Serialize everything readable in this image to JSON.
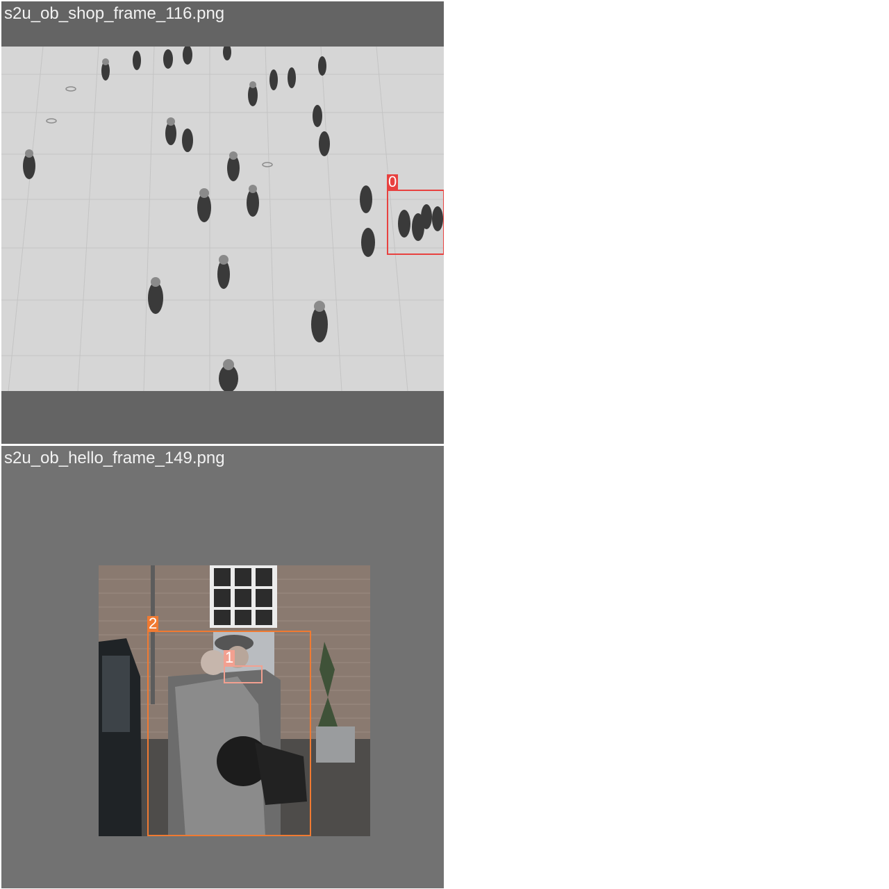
{
  "tiles": [
    {
      "filename": "s2u_ob_shop_frame_116.png",
      "photo": "grayscale overhead view of pedestrians walking across a tiled plaza",
      "detections": [
        {
          "id": "0",
          "color": "#e8413f"
        }
      ]
    },
    {
      "filename": "s2u_ob_hello_frame_149.png",
      "photo": "two men in suits and flat caps in front of a brick building with a vintage car and potted topiary",
      "detections": [
        {
          "id": "2",
          "color": "#f07a32"
        },
        {
          "id": "1",
          "color": "#f2a090"
        }
      ]
    }
  ]
}
